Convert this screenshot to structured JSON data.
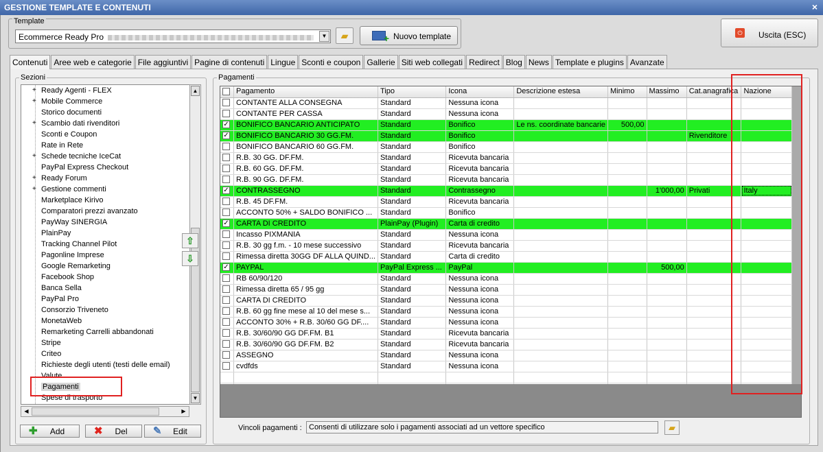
{
  "window": {
    "title": "GESTIONE TEMPLATE E CONTENUTI",
    "close": "×"
  },
  "template": {
    "label": "Template",
    "selected": "Ecommerce Ready Pro",
    "new_button": "Nuovo template",
    "exit_button": "Uscita (ESC)"
  },
  "tabs": [
    "Contenuti",
    "Aree web e categorie",
    "File aggiuntivi",
    "Pagine di contenuti",
    "Lingue",
    "Sconti e coupon",
    "Gallerie",
    "Siti web collegati",
    "Redirect",
    "Blog",
    "News",
    "Template e plugins",
    "Avanzate"
  ],
  "sezioni": {
    "label": "Sezioni",
    "items": [
      {
        "label": "Ready Agenti - FLEX",
        "expand": "+"
      },
      {
        "label": "Mobile Commerce",
        "expand": "+"
      },
      {
        "label": "Storico documenti",
        "expand": ""
      },
      {
        "label": "Scambio dati rivenditori",
        "expand": "+"
      },
      {
        "label": "Sconti e Coupon",
        "expand": ""
      },
      {
        "label": "Rate in Rete",
        "expand": ""
      },
      {
        "label": "Schede tecniche IceCat",
        "expand": "+"
      },
      {
        "label": "PayPal Express Checkout",
        "expand": ""
      },
      {
        "label": "Ready Forum",
        "expand": "+"
      },
      {
        "label": "Gestione commenti",
        "expand": "+"
      },
      {
        "label": "Marketplace Kirivo",
        "expand": ""
      },
      {
        "label": "Comparatori prezzi avanzato",
        "expand": ""
      },
      {
        "label": "PayWay SINERGIA",
        "expand": ""
      },
      {
        "label": "PlainPay",
        "expand": ""
      },
      {
        "label": "Tracking Channel Pilot",
        "expand": ""
      },
      {
        "label": "Pagonline Imprese",
        "expand": ""
      },
      {
        "label": "Google Remarketing",
        "expand": ""
      },
      {
        "label": "Facebook Shop",
        "expand": ""
      },
      {
        "label": "Banca Sella",
        "expand": ""
      },
      {
        "label": "PayPal Pro",
        "expand": ""
      },
      {
        "label": "Consorzio Triveneto",
        "expand": ""
      },
      {
        "label": "MonetaWeb",
        "expand": ""
      },
      {
        "label": "Remarketing Carrelli abbandonati",
        "expand": ""
      },
      {
        "label": "Stripe",
        "expand": ""
      },
      {
        "label": "Criteo",
        "expand": ""
      },
      {
        "label": "Richieste degli utenti (testi delle email)",
        "expand": ""
      },
      {
        "label": "Valute",
        "expand": ""
      },
      {
        "label": "Pagamenti",
        "expand": "",
        "selected": true
      },
      {
        "label": "Spese di trasporto",
        "expand": ""
      }
    ],
    "add": "Add",
    "del": "Del",
    "edit": "Edit"
  },
  "pagamenti": {
    "label": "Pagamenti",
    "columns": [
      "Pagamento",
      "Tipo",
      "Icona",
      "Descrizione estesa",
      "Minimo",
      "Massimo",
      "Cat.anagrafica",
      "Nazione"
    ],
    "rows": [
      {
        "checked": false,
        "active": false,
        "cells": [
          "CONTANTE ALLA CONSEGNA",
          "Standard",
          "Nessuna icona",
          "",
          "",
          "",
          "",
          ""
        ]
      },
      {
        "checked": false,
        "active": false,
        "cells": [
          "CONTANTE PER CASSA",
          "Standard",
          "Nessuna icona",
          "",
          "",
          "",
          "",
          ""
        ]
      },
      {
        "checked": true,
        "active": true,
        "cells": [
          "BONIFICO BANCARIO ANTICIPATO",
          "Standard",
          "Bonifico",
          "Le ns. coordinate bancarie",
          "500,00",
          "",
          "",
          ""
        ]
      },
      {
        "checked": true,
        "active": true,
        "cells": [
          "BONIFICO BANCARIO 30 GG.FM.",
          "Standard",
          "Bonifico",
          "",
          "",
          "",
          "Rivenditore",
          ""
        ]
      },
      {
        "checked": false,
        "active": false,
        "cells": [
          "BONIFICO BANCARIO 60 GG.FM.",
          "Standard",
          "Bonifico",
          "",
          "",
          "",
          "",
          ""
        ]
      },
      {
        "checked": false,
        "active": false,
        "cells": [
          "R.B. 30 GG. DF.FM.",
          "Standard",
          "Ricevuta bancaria",
          "",
          "",
          "",
          "",
          ""
        ]
      },
      {
        "checked": false,
        "active": false,
        "cells": [
          "R.B. 60 GG. DF.FM.",
          "Standard",
          "Ricevuta bancaria",
          "",
          "",
          "",
          "",
          ""
        ]
      },
      {
        "checked": false,
        "active": false,
        "cells": [
          "R.B. 90 GG. DF.FM.",
          "Standard",
          "Ricevuta bancaria",
          "",
          "",
          "",
          "",
          ""
        ]
      },
      {
        "checked": true,
        "active": true,
        "cells": [
          "CONTRASSEGNO",
          "Standard",
          "Contrassegno",
          "",
          "",
          "1'000,00",
          "Privati",
          "Italy"
        ]
      },
      {
        "checked": false,
        "active": false,
        "cells": [
          "R.B. 45 DF.FM.",
          "Standard",
          "Ricevuta bancaria",
          "",
          "",
          "",
          "",
          ""
        ]
      },
      {
        "checked": false,
        "active": false,
        "cells": [
          "ACCONTO 50% + SALDO BONIFICO ...",
          "Standard",
          "Bonifico",
          "",
          "",
          "",
          "",
          ""
        ]
      },
      {
        "checked": true,
        "active": true,
        "cells": [
          "CARTA DI CREDITO",
          "PlainPay (Plugin)",
          "Carta di credito",
          "",
          "",
          "",
          "",
          ""
        ]
      },
      {
        "checked": false,
        "active": false,
        "cells": [
          "Incasso PIXMANIA",
          "Standard",
          "Nessuna icona",
          "",
          "",
          "",
          "",
          ""
        ]
      },
      {
        "checked": false,
        "active": false,
        "cells": [
          "R.B. 30 gg f.m. - 10 mese successivo",
          "Standard",
          "Ricevuta bancaria",
          "",
          "",
          "",
          "",
          ""
        ]
      },
      {
        "checked": false,
        "active": false,
        "cells": [
          "Rimessa diretta 30GG DF ALLA QUIND...",
          "Standard",
          "Carta di credito",
          "",
          "",
          "",
          "",
          ""
        ]
      },
      {
        "checked": true,
        "active": true,
        "cells": [
          "PAYPAL",
          "PayPal Express ...",
          "PayPal",
          "",
          "",
          "500,00",
          "",
          ""
        ]
      },
      {
        "checked": false,
        "active": false,
        "cells": [
          "RB 60/90/120",
          "Standard",
          "Nessuna icona",
          "",
          "",
          "",
          "",
          ""
        ]
      },
      {
        "checked": false,
        "active": false,
        "cells": [
          "Rimessa diretta 65 / 95 gg",
          "Standard",
          "Nessuna icona",
          "",
          "",
          "",
          "",
          ""
        ]
      },
      {
        "checked": false,
        "active": false,
        "cells": [
          "CARTA DI CREDITO",
          "Standard",
          "Nessuna icona",
          "",
          "",
          "",
          "",
          ""
        ]
      },
      {
        "checked": false,
        "active": false,
        "cells": [
          "R.B. 60 gg fine mese al 10 del mese s...",
          "Standard",
          "Nessuna icona",
          "",
          "",
          "",
          "",
          ""
        ]
      },
      {
        "checked": false,
        "active": false,
        "cells": [
          "ACCONTO 30% + R.B. 30/60 GG DF....",
          "Standard",
          "Nessuna icona",
          "",
          "",
          "",
          "",
          ""
        ]
      },
      {
        "checked": false,
        "active": false,
        "cells": [
          "R.B. 30/60/90 GG DF.FM. B1",
          "Standard",
          "Ricevuta bancaria",
          "",
          "",
          "",
          "",
          ""
        ]
      },
      {
        "checked": false,
        "active": false,
        "cells": [
          "R.B. 30/60/90 GG DF.FM. B2",
          "Standard",
          "Ricevuta bancaria",
          "",
          "",
          "",
          "",
          ""
        ]
      },
      {
        "checked": false,
        "active": false,
        "cells": [
          "ASSEGNO",
          "Standard",
          "Nessuna icona",
          "",
          "",
          "",
          "",
          ""
        ]
      },
      {
        "checked": false,
        "active": false,
        "cells": [
          "cvdfds",
          "Standard",
          "Nessuna icona",
          "",
          "",
          "",
          "",
          ""
        ]
      }
    ],
    "vincoli_label": "Vincoli pagamenti :",
    "vincoli_value": "Consenti di utilizzare solo i pagamenti associati ad un vettore specifico"
  },
  "colors": {
    "active_row": "#22ee22",
    "highlight": "#e02020"
  }
}
